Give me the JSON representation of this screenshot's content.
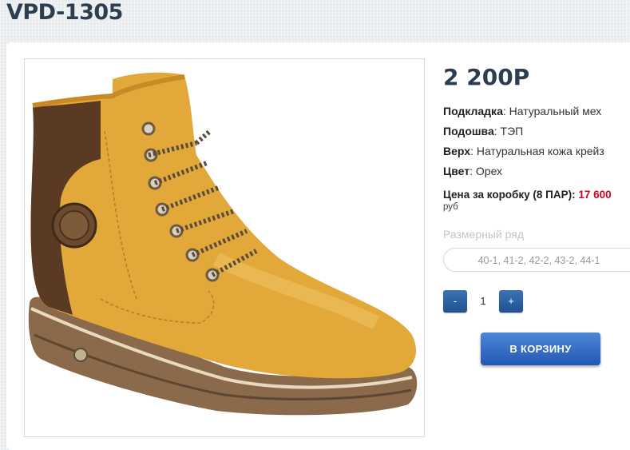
{
  "product": {
    "title": "VPD-1305",
    "price": "2 200Р",
    "image_alt": "boot-photo"
  },
  "specs": [
    {
      "label": "Подкладка",
      "value": ": Натуральный мех"
    },
    {
      "label": "Подошва",
      "value": ": ТЭП"
    },
    {
      "label": "Верх",
      "value": ": Натуральная кожа крейз"
    },
    {
      "label": "Цвет",
      "value": ": Орех"
    }
  ],
  "box": {
    "label": "Цена за коробку (8 ПАР):",
    "price": "17 600",
    "currency": "руб"
  },
  "sizes": {
    "label": "Размерный ряд",
    "value": "40-1, 41-2, 42-2, 43-2, 44-1"
  },
  "quantity": {
    "minus": "-",
    "value": "1",
    "plus": "+"
  },
  "cart_button": "В КОРЗИНУ",
  "colors": {
    "accent": "#2a5fa8",
    "box_price": "#d0021b",
    "title": "#2c3e50"
  }
}
